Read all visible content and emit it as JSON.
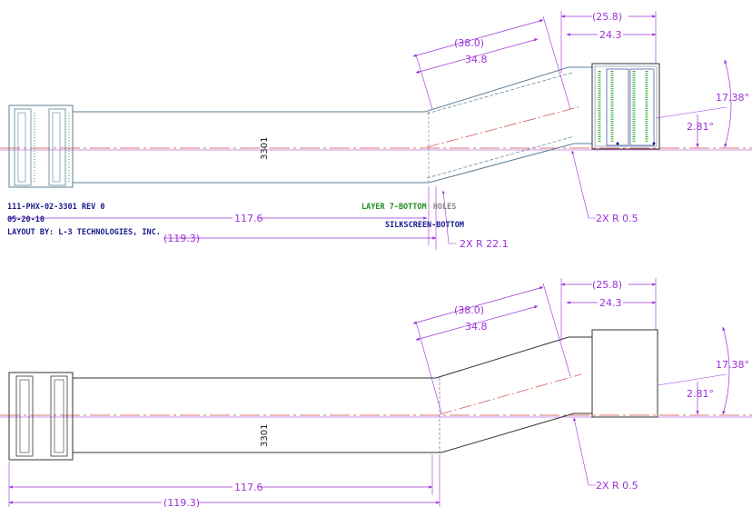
{
  "colors": {
    "dimension": "#9b30d9",
    "outline_top": "#5b7f95",
    "outline_bottom": "#333333",
    "centerline": "#d44a4a",
    "pads": "#22aa22",
    "note_navy": "#1a1a8c",
    "note_green": "#1f8f1f"
  },
  "top_view": {
    "part_label": "3301",
    "dims": {
      "overall": "(119.3)",
      "length": "117.6",
      "angled_outer": "(38.0)",
      "angled_inner": "34.8",
      "conn_outer": "(25.8)",
      "conn_inner": "24.3",
      "angle_large": "17.38°",
      "angle_small": "2.81°",
      "radius_small": "2X R 0.5",
      "radius_large": "2X R 22.1"
    },
    "notes": {
      "part_number": "111-PHX-02-3301 REV 0",
      "date": "05-20-10",
      "layout_by": "LAYOUT BY: L-3 TECHNOLOGIES, INC.",
      "layer_green": "LAYER 7-BOTTOM",
      "layer_gray": "HOLES",
      "silkscreen": "SILKSCREEN-BOTTOM"
    }
  },
  "bottom_view": {
    "part_label": "3301",
    "dims": {
      "overall": "(119.3)",
      "length": "117.6",
      "angled_outer": "(38.0)",
      "angled_inner": "34.8",
      "conn_outer": "(25.8)",
      "conn_inner": "24.3",
      "angle_large": "17.38°",
      "angle_small": "2.81°",
      "radius_small": "2X R 0.5"
    }
  }
}
